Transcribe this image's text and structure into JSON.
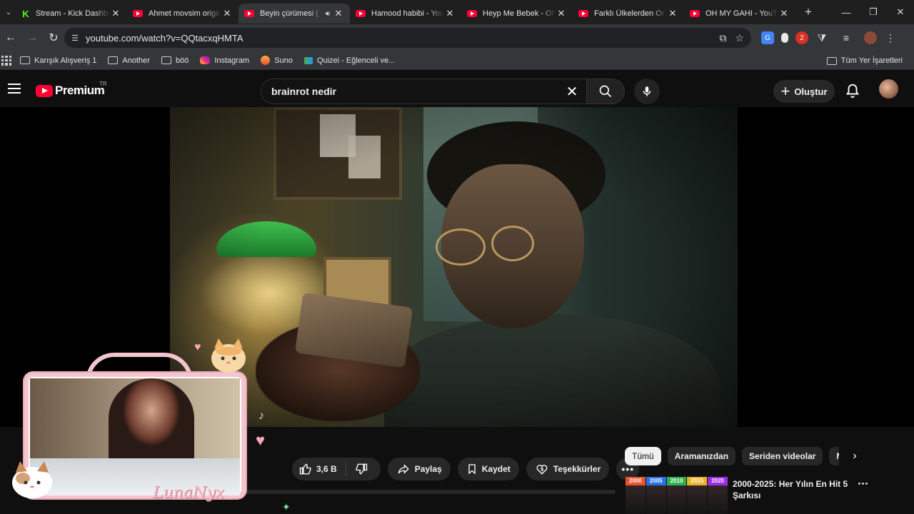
{
  "browser": {
    "tabs": [
      {
        "title": "Stream - Kick Dashboard",
        "favicon": "kick-icon",
        "active": false
      },
      {
        "title": "Ahmet movsim original",
        "favicon": "youtube-icon",
        "active": false
      },
      {
        "title": "Beyin çürümesi (",
        "favicon": "youtube-icon",
        "active": true,
        "audio": true
      },
      {
        "title": "Hamood habibi - YouTube",
        "favicon": "youtube-icon",
        "active": false
      },
      {
        "title": "Heyp Me Bebek - Oh",
        "favicon": "youtube-icon",
        "active": false
      },
      {
        "title": "Farklı Ülkelerden Or",
        "favicon": "youtube-icon",
        "active": false
      },
      {
        "title": "OH MY GAHI - YouTube",
        "favicon": "youtube-icon",
        "active": false
      }
    ],
    "url": "youtube.com/watch?v=QQtacxqHMTA",
    "bookmarks": [
      {
        "label": "Karışık Alışveriş 1",
        "icon": "folder-icon"
      },
      {
        "label": "Another",
        "icon": "folder-icon"
      },
      {
        "label": "böö",
        "icon": "folder-icon"
      },
      {
        "label": "Instagram",
        "icon": "instagram-icon"
      },
      {
        "label": "Suno",
        "icon": "suno-icon"
      },
      {
        "label": "Quizei - Eğlenceli ve...",
        "icon": "quizei-icon"
      }
    ],
    "all_bookmarks_label": "Tüm Yer İşaretleri"
  },
  "youtube": {
    "brand": "Premium",
    "region": "TR",
    "search": {
      "value": "brainrot nedir"
    },
    "create_label": "Oluştur",
    "actions": {
      "likes": "3,6 B",
      "share": "Paylaş",
      "save": "Kaydet",
      "thanks": "Teşekkürler"
    },
    "chips": [
      "Tümü",
      "Aramanızdan",
      "Seriden videolar",
      "Mi"
    ],
    "recommendation": {
      "thumb_labels": [
        "2000",
        "2005",
        "2010",
        "2015",
        "2020"
      ],
      "thumb_colors": [
        "#e8532b",
        "#2b6fe8",
        "#2bb24c",
        "#e8b22b",
        "#9b2be8"
      ],
      "title": "2000-2025: Her Yılın En Hit 5 Şarkısı"
    }
  },
  "overlay": {
    "signature": "LunaNyx"
  }
}
